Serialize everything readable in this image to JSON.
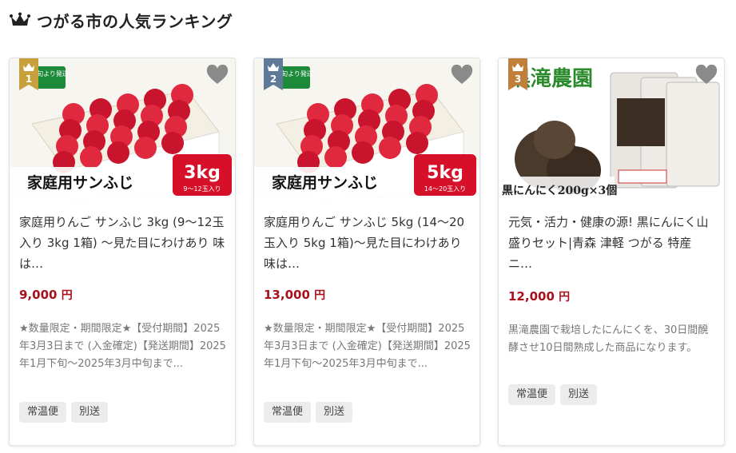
{
  "heading": {
    "title": "つがる市の人気ランキング",
    "icon": "crown-icon"
  },
  "colors": {
    "gold": "#c7a03c",
    "silver": "#5f7a99",
    "bronze": "#c17f3c",
    "price": "#a8111c"
  },
  "products": [
    {
      "rank": "1",
      "image_text": {
        "badge": "上旬より発送",
        "label": "家庭用サンふじ",
        "weight": "3kg",
        "count": "9〜12玉入り"
      },
      "title": "家庭用りんご サンふじ 3kg (9〜12玉入り 3kg 1箱) 〜見た目にわけあり 味は…",
      "price": "9,000",
      "yen": "円",
      "description": "★数量限定・期間限定★【受付期間】2025年3月3日まで (入金確定)【発送期間】2025年1月下旬〜2025年3月中旬まで...",
      "tags": [
        "常温便",
        "別送"
      ]
    },
    {
      "rank": "2",
      "image_text": {
        "badge": "上旬より発送",
        "label": "家庭用サンふじ",
        "weight": "5kg",
        "count": "14〜20玉入り"
      },
      "title": "家庭用りんご サンふじ 5kg (14〜20玉入り 5kg 1箱)〜見た目にわけあり 味は…",
      "price": "13,000",
      "yen": "円",
      "description": "★数量限定・期間限定★【受付期間】2025年3月3日まで (入金確定)【発送期間】2025年1月下旬〜2025年3月中旬まで...",
      "tags": [
        "常温便",
        "別送"
      ]
    },
    {
      "rank": "3",
      "image_text": {
        "brand": "黒滝農園",
        "caption": "黒にんにく200g×3個"
      },
      "title": "元気・活力・健康の源! 黒にんにく山盛りセット|青森 津軽 つがる 特産 ニ…",
      "price": "12,000",
      "yen": "円",
      "description": "黒滝農園で栽培したにんにくを、30日間醗酵させ10日間熟成した商品になります。",
      "tags": [
        "常温便",
        "別送"
      ]
    }
  ]
}
